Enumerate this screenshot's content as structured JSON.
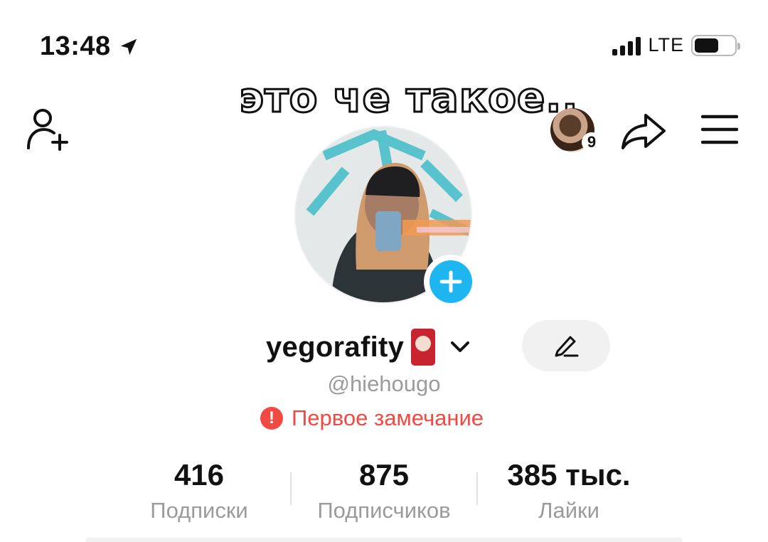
{
  "status_bar": {
    "time": "13:48",
    "network": "LTE",
    "location_icon": "location-arrow-icon"
  },
  "caption": "это че такое..",
  "header": {
    "add_friend_icon": "add-friend-icon",
    "story_badge_count": "9",
    "share_icon": "share-icon",
    "menu_icon": "menu-icon"
  },
  "profile": {
    "username": "yegorafity",
    "handle": "@hiehougo",
    "warning": "Первое замечание",
    "warning_icon": "exclamation-icon",
    "accent_color": "#1db6f0",
    "warning_color": "#f04a42"
  },
  "stats": [
    {
      "value": "416",
      "label": "Подписки"
    },
    {
      "value": "875",
      "label": "Подписчиков"
    },
    {
      "value": "385 тыс.",
      "label": "Лайки"
    }
  ]
}
